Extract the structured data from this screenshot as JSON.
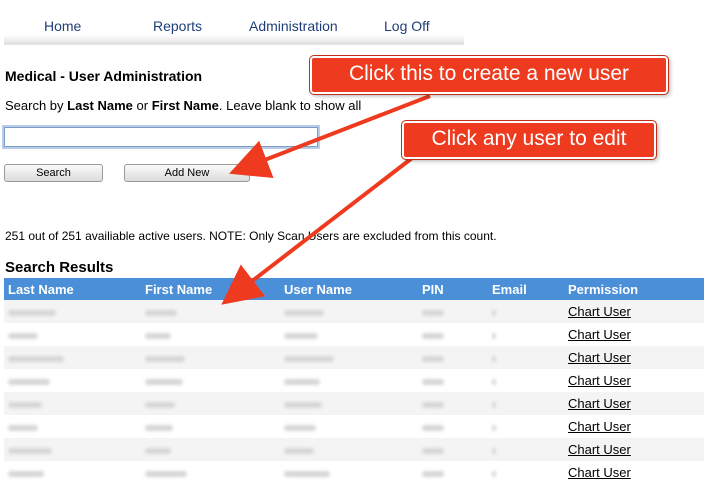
{
  "nav": {
    "items": [
      {
        "label": "Home"
      },
      {
        "label": "Reports"
      },
      {
        "label": "Administration"
      },
      {
        "label": "Log Off"
      }
    ]
  },
  "page": {
    "title": "Medical - User Administration",
    "instruction": {
      "prefix": "Search by ",
      "last_name": "Last Name",
      "or": " or ",
      "first_name": "First Name",
      "suffix": ". Leave blank to show all"
    }
  },
  "search": {
    "value": "",
    "search_label": "Search",
    "add_new_label": "Add New"
  },
  "count_text": "251 out of 251 availiable active users. NOTE: Only Scan Users are excluded from this count.",
  "results": {
    "heading": "Search Results",
    "columns": [
      "Last Name",
      "First Name",
      "User Name",
      "PIN",
      "Email",
      "Permission"
    ],
    "rows": [
      {
        "permission": "Chart User"
      },
      {
        "permission": "Chart User"
      },
      {
        "permission": "Chart User"
      },
      {
        "permission": "Chart User"
      },
      {
        "permission": "Chart User"
      },
      {
        "permission": "Chart User"
      },
      {
        "permission": "Chart User"
      },
      {
        "permission": "Chart User"
      }
    ]
  },
  "annotations": {
    "create_user": "Click this to create a new user",
    "edit_user": "Click any user to edit"
  },
  "colors": {
    "nav_link": "#1f3e78",
    "table_header": "#4a8fd8",
    "callout": "#ee3b1f",
    "arrow": "#ee3b1f"
  }
}
